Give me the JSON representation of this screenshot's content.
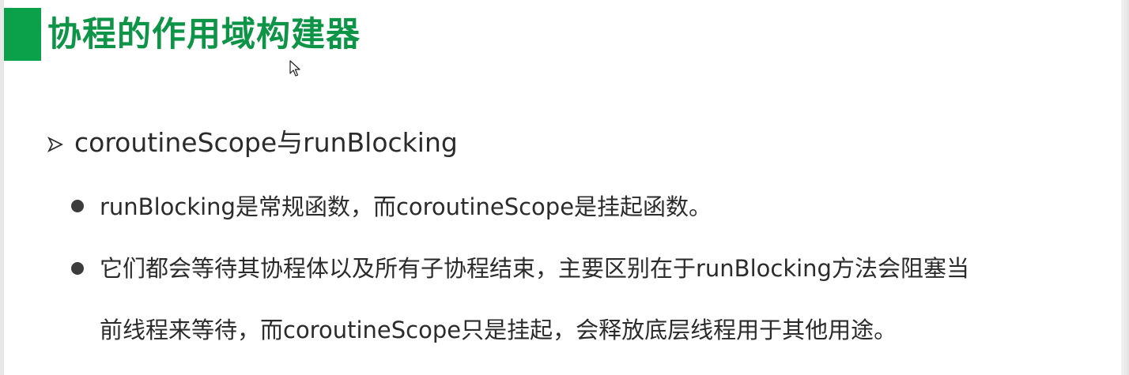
{
  "slide": {
    "title": "协程的作用域构建器",
    "heading": "coroutineScope与runBlocking",
    "points": [
      "runBlocking是常规函数，而coroutineScope是挂起函数。",
      "它们都会等待其协程体以及所有子协程结束，主要区别在于runBlocking方法会阻塞当",
      "前线程来等待，而coroutineScope只是挂起，会释放底层线程用于其他用途。"
    ]
  },
  "colors": {
    "accent": "#0ba14b",
    "title_text": "#0d9446",
    "body_text": "#2b2b2b"
  },
  "icons": {
    "heading_marker": "arrowhead-icon",
    "point_marker": "bullet-dot-icon",
    "pointer": "mouse-cursor-icon"
  }
}
